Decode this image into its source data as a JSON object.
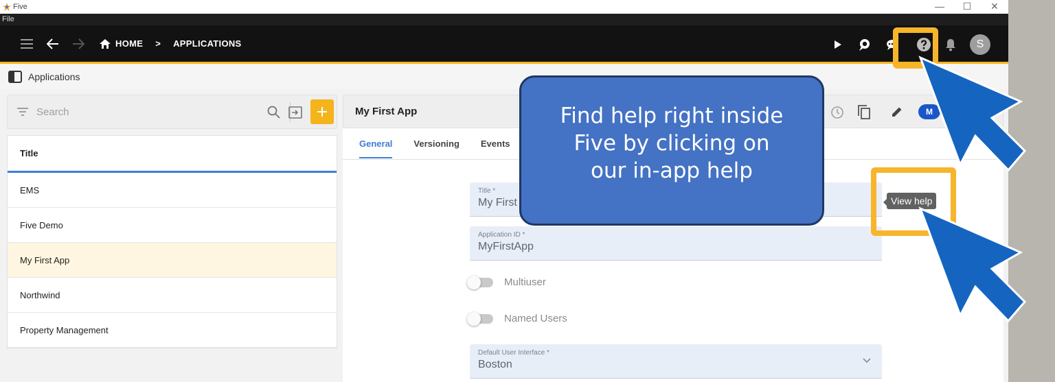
{
  "window": {
    "title": "Five",
    "controls": [
      "—",
      "☐",
      "✕"
    ]
  },
  "menubar": {
    "file_label": "File"
  },
  "navbar": {
    "home_label": "HOME",
    "separator": ">",
    "applications_label": "APPLICATIONS",
    "avatar_letter": "S"
  },
  "subheader": {
    "title": "Applications"
  },
  "search": {
    "placeholder": "Search"
  },
  "list": {
    "header": "Title",
    "items": [
      "EMS",
      "Five Demo",
      "My First App",
      "Northwind",
      "Property Management"
    ],
    "selected_index": 2
  },
  "detail": {
    "title": "My First App",
    "badge_initial": "M",
    "tabs": [
      "General",
      "Versioning",
      "Events"
    ],
    "active_tab": "General",
    "fields": {
      "title_label": "Title *",
      "title_value": "My First",
      "app_id_label": "Application ID *",
      "app_id_value": "MyFirstApp",
      "multiuser_label": "Multiuser",
      "named_users_label": "Named Users",
      "default_ui_label": "Default User Interface *",
      "default_ui_value": "Boston"
    }
  },
  "overlay": {
    "callout_line1": "Find help right inside",
    "callout_line2": "Five by clicking on",
    "callout_line3": "our in-app help",
    "tooltip": "View help"
  },
  "colors": {
    "accent": "#f5b31c",
    "navbar_bg": "#121212",
    "link_blue": "#3e7dd6",
    "callout_bg": "#4472c4",
    "arrow_blue": "#1565c0",
    "highlight": "#f7b52c"
  }
}
